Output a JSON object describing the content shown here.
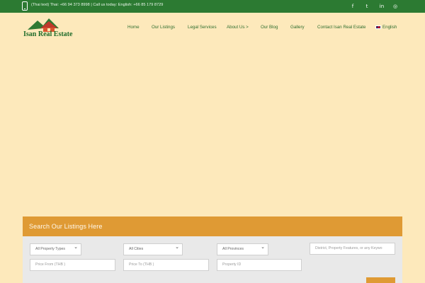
{
  "topbar": {
    "contact_text": "(Thai text) Thai: +66 94 373 8998 | Call us today: English: +66 85 179 8729",
    "socials": [
      {
        "icon": "facebook-icon",
        "glyph": "f"
      },
      {
        "icon": "twitter-icon",
        "glyph": "t"
      },
      {
        "icon": "linkedin-icon",
        "glyph": "in"
      },
      {
        "icon": "instagram-icon",
        "glyph": "◎"
      }
    ]
  },
  "header": {
    "logo_text": "Isan Real Estate",
    "nav": [
      {
        "label": "Home"
      },
      {
        "label": "Our Listings"
      },
      {
        "label": "Legal Services"
      },
      {
        "label": "About Us >"
      },
      {
        "label": "Our Blog"
      },
      {
        "label": "Gallery"
      },
      {
        "label": "Contact Isan Real Estate"
      }
    ],
    "language": "English"
  },
  "search": {
    "title": "Search Our Listings Here",
    "property_types": "All Property Types",
    "cities": "All Cities",
    "provinces": "All Provinces",
    "keywords_placeholder": "District, Property Features, or any Keywo",
    "price_from_placeholder": "Price From (THB )",
    "price_to_placeholder": "Price To (THB )",
    "property_id_placeholder": "Property ID"
  },
  "colors": {
    "topbar": "#2c7a32",
    "background": "#fde9bb",
    "accent": "#df9a34",
    "nav_text": "#2f6e2f",
    "search_body": "#e9e9e9"
  }
}
